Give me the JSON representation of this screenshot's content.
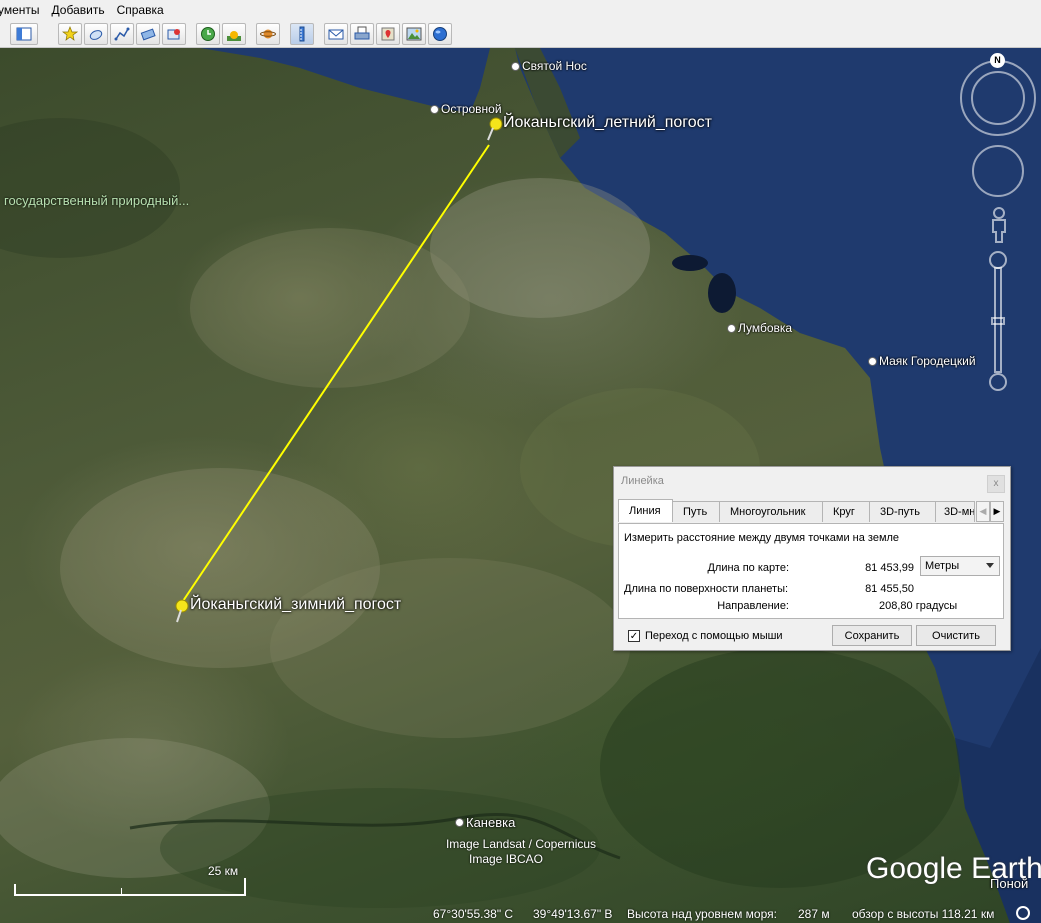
{
  "menu": {
    "items": [
      "ументы",
      "Добавить",
      "Справка"
    ]
  },
  "toolbar": {
    "icons": [
      "sidebar-toggle-icon",
      "placemark-icon",
      "polygon-icon",
      "path-icon",
      "overlay-icon",
      "tour-icon",
      "history-icon",
      "sunlight-icon",
      "planets-icon",
      "ruler-icon",
      "email-icon",
      "print-icon",
      "google-maps-icon",
      "image-icon",
      "globe-icon"
    ]
  },
  "map": {
    "places": {
      "svyatoy_nos": "Святой Нос",
      "ostrovnoy": "Островной",
      "lumbovka": "Лумбовка",
      "mayak": "Маяк Городецкий",
      "kanevka": "Каневка",
      "ponoy": "Поной"
    },
    "placemarks": {
      "summer": "Йоканьгский_летний_погост",
      "winter": "Йоканьгский_зимний_погост"
    },
    "reserve_label": "государственный природный...",
    "attribution": [
      "Image Landsat / Copernicus",
      "Image IBCAO"
    ],
    "scale_label": "25 км",
    "logo": "Google Earth",
    "compass_letter": "N"
  },
  "ruler": {
    "title": "Линейка",
    "close": "x",
    "tabs": [
      "Линия",
      "Путь",
      "Многоугольник",
      "Круг",
      "3D-путь",
      "3D-мн"
    ],
    "description": "Измерить расстояние между двумя точками на земле",
    "map_length_label": "Длина по карте:",
    "map_length_value": "81 453,99",
    "unit": "Метры",
    "ground_length_label": "Длина по поверхности планеты:",
    "ground_length_value": "81 455,50",
    "heading_label": "Направление:",
    "heading_value": "208,80 градусы",
    "mouse_nav_label": "Переход с помощью мыши",
    "mouse_nav_checked": "✓",
    "save_label": "Сохранить",
    "clear_label": "Очистить"
  },
  "status": {
    "lat": "67°30'55.38\" С",
    "lon": "39°49'13.67\" В",
    "elevation_label": "Высота над уровнем моря:",
    "elevation_value": "287 м",
    "eye_alt": "обзор с высоты 118.21 км"
  },
  "colors": {
    "measure_line": "#ffff00",
    "sea": "#1f3a6e",
    "reserve_text": "#b7e0b0"
  }
}
